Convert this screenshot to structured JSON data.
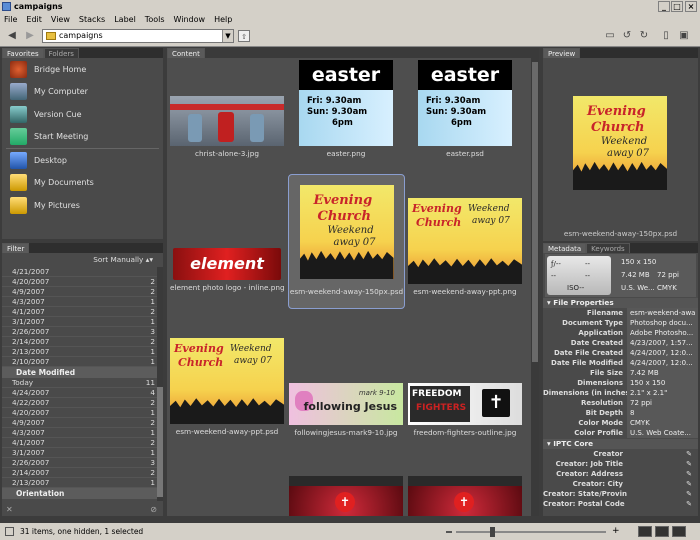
{
  "window": {
    "title": "campaigns",
    "min": "_",
    "max": "□",
    "close": "×"
  },
  "menu": [
    "File",
    "Edit",
    "View",
    "Stacks",
    "Label",
    "Tools",
    "Window",
    "Help"
  ],
  "toolbar": {
    "path": "campaigns"
  },
  "favorites": {
    "tabs": [
      "Favorites",
      "Folders"
    ],
    "items": [
      "Bridge Home",
      "My Computer",
      "Version Cue",
      "Start Meeting",
      "Desktop",
      "My Documents",
      "My Pictures"
    ]
  },
  "filter": {
    "tab": "Filter",
    "sort": "Sort Manually",
    "rows_top": [
      {
        "label": "4/21/2007",
        "count": ""
      },
      {
        "label": "4/20/2007",
        "count": "2"
      },
      {
        "label": "4/9/2007",
        "count": "2"
      },
      {
        "label": "4/3/2007",
        "count": "1"
      },
      {
        "label": "4/1/2007",
        "count": "2"
      },
      {
        "label": "3/1/2007",
        "count": "1"
      },
      {
        "label": "2/26/2007",
        "count": "3"
      },
      {
        "label": "2/14/2007",
        "count": "2"
      },
      {
        "label": "2/13/2007",
        "count": "1"
      },
      {
        "label": "2/10/2007",
        "count": "1"
      }
    ],
    "date_modified_header": "Date Modified",
    "rows_dm": [
      {
        "label": "Today",
        "count": "11"
      },
      {
        "label": "4/24/2007",
        "count": "4"
      },
      {
        "label": "4/22/2007",
        "count": "2"
      },
      {
        "label": "4/20/2007",
        "count": "1"
      },
      {
        "label": "4/9/2007",
        "count": "2"
      },
      {
        "label": "4/3/2007",
        "count": "1"
      },
      {
        "label": "4/1/2007",
        "count": "2"
      },
      {
        "label": "3/1/2007",
        "count": "1"
      },
      {
        "label": "2/26/2007",
        "count": "3"
      },
      {
        "label": "2/14/2007",
        "count": "2"
      },
      {
        "label": "2/13/2007",
        "count": "1"
      }
    ],
    "orientation_header": "Orientation"
  },
  "content": {
    "tab": "Content",
    "thumbs": [
      {
        "label": "christ-alone-3.jpg"
      },
      {
        "label": "easter.png"
      },
      {
        "label": "easter.psd"
      },
      {
        "label": "element photo logo - inline.png"
      },
      {
        "label": "esm-weekend-away-150px.psd"
      },
      {
        "label": "esm-weekend-away-ppt.png"
      },
      {
        "label": "esm-weekend-away-ppt.psd"
      },
      {
        "label": "followingjesus-mark9-10.jpg"
      },
      {
        "label": "freedom-fighters-outline.jpg"
      }
    ],
    "easter": {
      "word": "easter",
      "fri": "Fri:",
      "sun": "Sun:",
      "t1": "9.30am",
      "t2": "9.30am",
      "t3": "6pm"
    },
    "evening": {
      "l1": "Evening",
      "l2": "Church",
      "l3": "Weekend",
      "l4": "away 07"
    },
    "element": "element",
    "following": {
      "ref": "mark 9-10",
      "text": "following Jesus"
    },
    "freedom": {
      "l1": "FREEDOM",
      "l2": "FIGHTERS"
    }
  },
  "preview": {
    "tab": "Preview",
    "caption": "esm-weekend-away-150px.psd"
  },
  "metadata": {
    "tabs": [
      "Metadata",
      "Keywords"
    ],
    "summary": {
      "f": "ƒ/--",
      "dash1": "--",
      "dash2": "--",
      "dash3": "--",
      "iso": "ISO--",
      "dim": "150 x 150",
      "size": "7.42 MB",
      "ppi": "72 ppi",
      "profile": "U.S. We...",
      "mode": "CMYK"
    },
    "file_props_header": "File Properties",
    "props": [
      {
        "k": "Filename",
        "v": "esm-weekend-awa"
      },
      {
        "k": "Document Type",
        "v": "Photoshop docu..."
      },
      {
        "k": "Application",
        "v": "Adobe Photosho..."
      },
      {
        "k": "Date Created",
        "v": "4/23/2007, 1:57..."
      },
      {
        "k": "Date File Created",
        "v": "4/24/2007, 12:0..."
      },
      {
        "k": "Date File Modified",
        "v": "4/24/2007, 12:0..."
      },
      {
        "k": "File Size",
        "v": "7.42 MB"
      },
      {
        "k": "Dimensions",
        "v": "150 x 150"
      },
      {
        "k": "Dimensions (in inches)",
        "v": "2.1\" x 2.1\""
      },
      {
        "k": "Resolution",
        "v": "72 ppi"
      },
      {
        "k": "Bit Depth",
        "v": "8"
      },
      {
        "k": "Color Mode",
        "v": "CMYK"
      },
      {
        "k": "Color Profile",
        "v": "U.S. Web Coate..."
      }
    ],
    "iptc_header": "IPTC Core",
    "iptc": [
      "Creator",
      "Creator: Job Title",
      "Creator: Address",
      "Creator: City",
      "Creator: State/Province",
      "Creator: Postal Code"
    ]
  },
  "status": {
    "text": "31 items, one hidden, 1 selected"
  },
  "colors": {
    "panel": "#4a4a4a",
    "content": "#4e4e4e",
    "accent": "#3f5f9f",
    "chrome": "#d4d0c8"
  }
}
